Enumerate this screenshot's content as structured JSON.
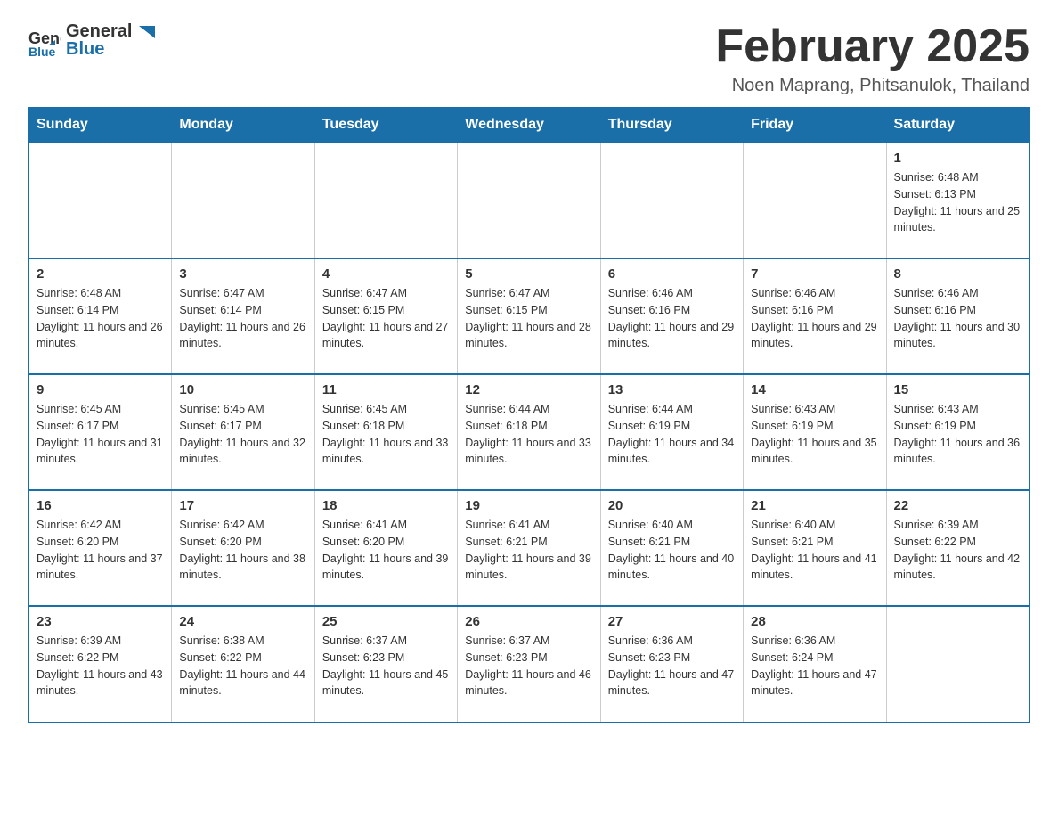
{
  "header": {
    "logo": {
      "text_general": "General",
      "text_blue": "Blue"
    },
    "title": "February 2025",
    "location": "Noen Maprang, Phitsanulok, Thailand"
  },
  "days_of_week": [
    "Sunday",
    "Monday",
    "Tuesday",
    "Wednesday",
    "Thursday",
    "Friday",
    "Saturday"
  ],
  "weeks": [
    [
      {
        "day": "",
        "info": ""
      },
      {
        "day": "",
        "info": ""
      },
      {
        "day": "",
        "info": ""
      },
      {
        "day": "",
        "info": ""
      },
      {
        "day": "",
        "info": ""
      },
      {
        "day": "",
        "info": ""
      },
      {
        "day": "1",
        "info": "Sunrise: 6:48 AM\nSunset: 6:13 PM\nDaylight: 11 hours and 25 minutes."
      }
    ],
    [
      {
        "day": "2",
        "info": "Sunrise: 6:48 AM\nSunset: 6:14 PM\nDaylight: 11 hours and 26 minutes."
      },
      {
        "day": "3",
        "info": "Sunrise: 6:47 AM\nSunset: 6:14 PM\nDaylight: 11 hours and 26 minutes."
      },
      {
        "day": "4",
        "info": "Sunrise: 6:47 AM\nSunset: 6:15 PM\nDaylight: 11 hours and 27 minutes."
      },
      {
        "day": "5",
        "info": "Sunrise: 6:47 AM\nSunset: 6:15 PM\nDaylight: 11 hours and 28 minutes."
      },
      {
        "day": "6",
        "info": "Sunrise: 6:46 AM\nSunset: 6:16 PM\nDaylight: 11 hours and 29 minutes."
      },
      {
        "day": "7",
        "info": "Sunrise: 6:46 AM\nSunset: 6:16 PM\nDaylight: 11 hours and 29 minutes."
      },
      {
        "day": "8",
        "info": "Sunrise: 6:46 AM\nSunset: 6:16 PM\nDaylight: 11 hours and 30 minutes."
      }
    ],
    [
      {
        "day": "9",
        "info": "Sunrise: 6:45 AM\nSunset: 6:17 PM\nDaylight: 11 hours and 31 minutes."
      },
      {
        "day": "10",
        "info": "Sunrise: 6:45 AM\nSunset: 6:17 PM\nDaylight: 11 hours and 32 minutes."
      },
      {
        "day": "11",
        "info": "Sunrise: 6:45 AM\nSunset: 6:18 PM\nDaylight: 11 hours and 33 minutes."
      },
      {
        "day": "12",
        "info": "Sunrise: 6:44 AM\nSunset: 6:18 PM\nDaylight: 11 hours and 33 minutes."
      },
      {
        "day": "13",
        "info": "Sunrise: 6:44 AM\nSunset: 6:19 PM\nDaylight: 11 hours and 34 minutes."
      },
      {
        "day": "14",
        "info": "Sunrise: 6:43 AM\nSunset: 6:19 PM\nDaylight: 11 hours and 35 minutes."
      },
      {
        "day": "15",
        "info": "Sunrise: 6:43 AM\nSunset: 6:19 PM\nDaylight: 11 hours and 36 minutes."
      }
    ],
    [
      {
        "day": "16",
        "info": "Sunrise: 6:42 AM\nSunset: 6:20 PM\nDaylight: 11 hours and 37 minutes."
      },
      {
        "day": "17",
        "info": "Sunrise: 6:42 AM\nSunset: 6:20 PM\nDaylight: 11 hours and 38 minutes."
      },
      {
        "day": "18",
        "info": "Sunrise: 6:41 AM\nSunset: 6:20 PM\nDaylight: 11 hours and 39 minutes."
      },
      {
        "day": "19",
        "info": "Sunrise: 6:41 AM\nSunset: 6:21 PM\nDaylight: 11 hours and 39 minutes."
      },
      {
        "day": "20",
        "info": "Sunrise: 6:40 AM\nSunset: 6:21 PM\nDaylight: 11 hours and 40 minutes."
      },
      {
        "day": "21",
        "info": "Sunrise: 6:40 AM\nSunset: 6:21 PM\nDaylight: 11 hours and 41 minutes."
      },
      {
        "day": "22",
        "info": "Sunrise: 6:39 AM\nSunset: 6:22 PM\nDaylight: 11 hours and 42 minutes."
      }
    ],
    [
      {
        "day": "23",
        "info": "Sunrise: 6:39 AM\nSunset: 6:22 PM\nDaylight: 11 hours and 43 minutes."
      },
      {
        "day": "24",
        "info": "Sunrise: 6:38 AM\nSunset: 6:22 PM\nDaylight: 11 hours and 44 minutes."
      },
      {
        "day": "25",
        "info": "Sunrise: 6:37 AM\nSunset: 6:23 PM\nDaylight: 11 hours and 45 minutes."
      },
      {
        "day": "26",
        "info": "Sunrise: 6:37 AM\nSunset: 6:23 PM\nDaylight: 11 hours and 46 minutes."
      },
      {
        "day": "27",
        "info": "Sunrise: 6:36 AM\nSunset: 6:23 PM\nDaylight: 11 hours and 47 minutes."
      },
      {
        "day": "28",
        "info": "Sunrise: 6:36 AM\nSunset: 6:24 PM\nDaylight: 11 hours and 47 minutes."
      },
      {
        "day": "",
        "info": ""
      }
    ]
  ]
}
